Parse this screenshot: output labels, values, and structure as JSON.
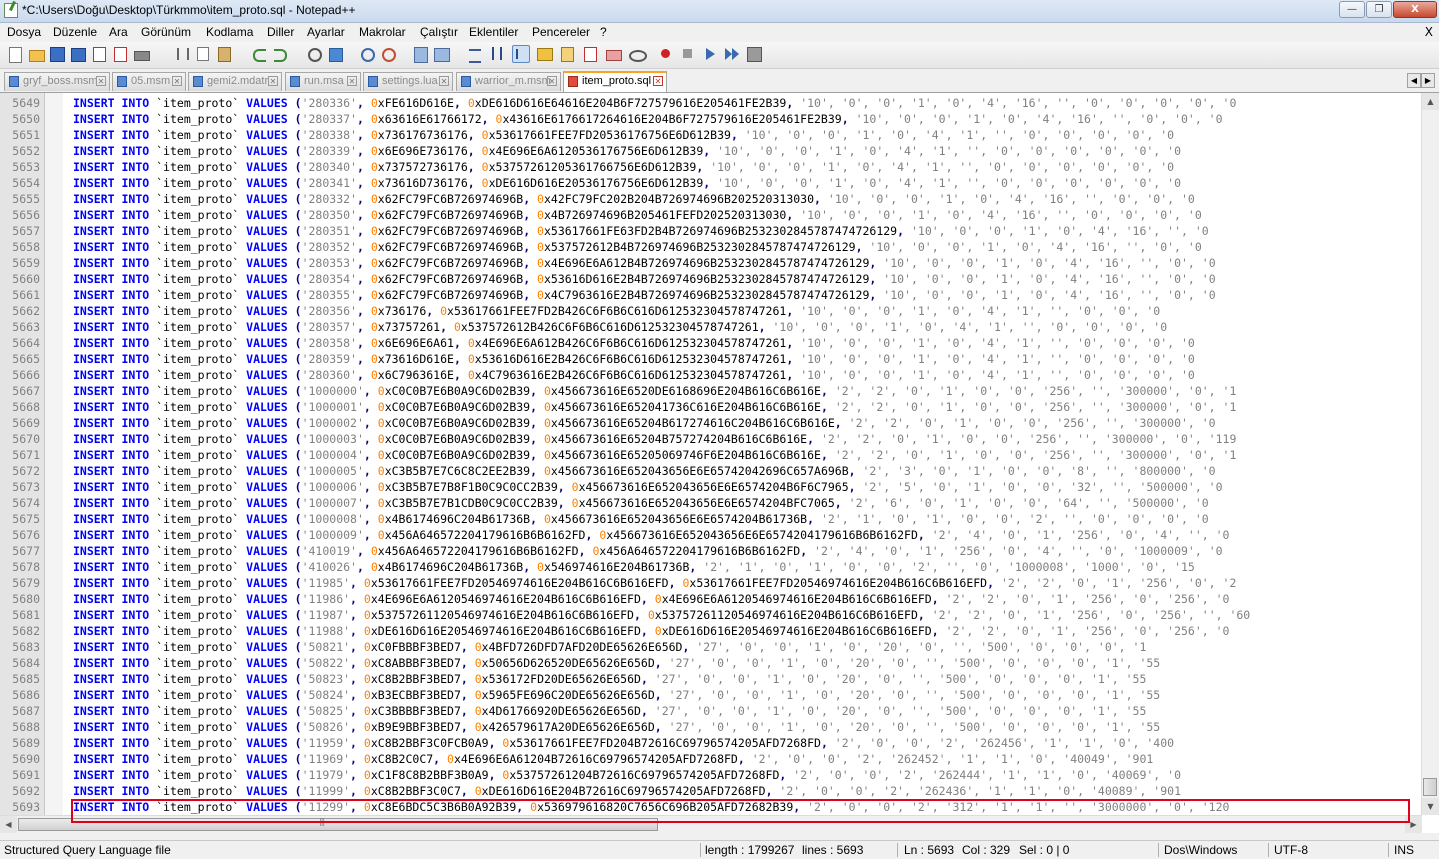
{
  "window": {
    "title": "*C:\\Users\\Doğu\\Desktop\\Türkmmo\\item_proto.sql - Notepad++",
    "minimize_label": "—",
    "restore_label": "❐",
    "close_label": "X"
  },
  "menu": {
    "items": [
      "Dosya",
      "Düzenle",
      "Ara",
      "Görünüm",
      "Kodlama",
      "Diller",
      "Ayarlar",
      "Makrolar",
      "Çalıştır",
      "Eklentiler",
      "Pencereler",
      "?"
    ],
    "close_doc": "X"
  },
  "tabs": [
    {
      "label": "gryf_boss.msm",
      "active": false
    },
    {
      "label": "05.msm",
      "active": false
    },
    {
      "label": "gemi2.mdatr",
      "active": false
    },
    {
      "label": "run.msa",
      "active": false
    },
    {
      "label": "settings.lua",
      "active": false
    },
    {
      "label": "warrior_m.msm",
      "active": false
    },
    {
      "label": "item_proto.sql",
      "active": true
    }
  ],
  "code": {
    "kw_insert": "INSERT",
    "kw_into": "INTO",
    "table": "`item_proto`",
    "kw_values": "VALUES",
    "lines": [
      {
        "n": "5649",
        "id": "'280336'",
        "h1": "FE616D616E",
        "h2": "DE616D616E64616E204B6F727579616E205461FE2B39",
        "rest": "'10', '0', '0', '1', '0', '4', '16', '', '0', '0', '0', '0', '0"
      },
      {
        "n": "5650",
        "id": "'280337'",
        "h1": "63616E61766172",
        "h2": "43616E6176617264616E204B6F727579616E205461FE2B39",
        "rest": "'10', '0', '0', '1', '0', '4', '16', '', '0', '0', '0"
      },
      {
        "n": "5651",
        "id": "'280338'",
        "h1": "736176736176",
        "h2": "53617661FEE7FD20536176756E6D612B39",
        "rest": "'10', '0', '0', '1', '0', '4', '1', '', '0', '0', '0', '0', '0"
      },
      {
        "n": "5652",
        "id": "'280339'",
        "h1": "6E696E736176",
        "h2": "4E696E6A6120536176756E6D612B39",
        "rest": "'10', '0', '0', '1', '0', '4', '1', '', '0', '0', '0', '0', '0', '0"
      },
      {
        "n": "5653",
        "id": "'280340'",
        "h1": "737572736176",
        "h2": "53757261205361766756E6D612B39",
        "rest": "'10', '0', '0', '1', '0', '4', '1', '', '0', '0', '0', '0', '0', '0"
      },
      {
        "n": "5654",
        "id": "'280341'",
        "h1": "73616D736176",
        "h2": "DE616D616E20536176756E6D612B39",
        "rest": "'10', '0', '0', '1', '0', '4', '1', '', '0', '0', '0', '0', '0', '0"
      },
      {
        "n": "5655",
        "id": "'280332'",
        "h1": "62FC79FC6B726974696B",
        "h2": "42FC79FC202B204B726974696B202520313030",
        "rest": "'10', '0', '0', '1', '0', '4', '16', '', '0', '0', '0"
      },
      {
        "n": "5656",
        "id": "'280350'",
        "h1": "62FC79FC6B726974696B",
        "h2": "4B726974696B205461FEFD202520313030",
        "rest": "'10', '0', '0', '1', '0', '4', '16', '', '0', '0', '0', '0"
      },
      {
        "n": "5657",
        "id": "'280351'",
        "h1": "62FC79FC6B726974696B",
        "h2": "53617661FE63FD2B4B726974696B2532302845787474726129",
        "rest": "'10', '0', '0', '1', '0', '4', '16', '', '0"
      },
      {
        "n": "5658",
        "id": "'280352'",
        "h1": "62FC79FC6B726974696B",
        "h2": "537572612B4B726974696B2532302845787474726129",
        "rest": "'10', '0', '0', '1', '0', '4', '16', '', '0', '0"
      },
      {
        "n": "5659",
        "id": "'280353'",
        "h1": "62FC79FC6B726974696B",
        "h2": "4E696E6A612B4B726974696B2532302845787474726129",
        "rest": "'10', '0', '0', '1', '0', '4', '16', '', '0', '0"
      },
      {
        "n": "5660",
        "id": "'280354'",
        "h1": "62FC79FC6B726974696B",
        "h2": "53616D616E2B4B726974696B2532302845787474726129",
        "rest": "'10', '0', '0', '1', '0', '4', '16', '', '0', '0"
      },
      {
        "n": "5661",
        "id": "'280355'",
        "h1": "62FC79FC6B726974696B",
        "h2": "4C7963616E2B4B726974696B2532302845787474726129",
        "rest": "'10', '0', '0', '1', '0', '4', '16', '', '0', '0"
      },
      {
        "n": "5662",
        "id": "'280356'",
        "h1": "736176",
        "h2": "53617661FEE7FD2B426C6F6B6C616D612532304578747261",
        "rest": "'10', '0', '0', '1', '0', '4', '1', '', '0', '0', '0"
      },
      {
        "n": "5663",
        "id": "'280357'",
        "h1": "73757261",
        "h2": "537572612B426C6F6B6C616D612532304578747261",
        "rest": "'10', '0', '0', '1', '0', '4', '1', '', '0', '0', '0', '0"
      },
      {
        "n": "5664",
        "id": "'280358'",
        "h1": "6E696E6A61",
        "h2": "4E696E6A612B426C6F6B6C616D612532304578747261",
        "rest": "'10', '0', '0', '1', '0', '4', '1', '', '0', '0', '0', '0"
      },
      {
        "n": "5665",
        "id": "'280359'",
        "h1": "73616D616E",
        "h2": "53616D616E2B426C6F6B6C616D612532304578747261",
        "rest": "'10', '0', '0', '1', '0', '4', '1', '', '0', '0', '0', '0"
      },
      {
        "n": "5666",
        "id": "'280360'",
        "h1": "6C7963616E",
        "h2": "4C7963616E2B426C6F6B6C616D612532304578747261",
        "rest": "'10', '0', '0', '1', '0', '4', '1', '', '0', '0', '0', '0"
      },
      {
        "n": "5667",
        "id": "'1000000'",
        "h1": "C0C0B7E6B0A9C6D02B39",
        "h2": "456673616E6520DE6168696E204B616C6B616E",
        "rest": "'2', '2', '0', '1', '0', '0', '256', '', '300000', '0', '1"
      },
      {
        "n": "5668",
        "id": "'1000001'",
        "h1": "C0C0B7E6B0A9C6D02B39",
        "h2": "456673616E652041736C616E204B616C6B616E",
        "rest": "'2', '2', '0', '1', '0', '0', '256', '', '300000', '0', '1"
      },
      {
        "n": "5669",
        "id": "'1000002'",
        "h1": "C0C0B7E6B0A9C6D02B39",
        "h2": "456673616E65204B617274616C204B616C6B616E",
        "rest": "'2', '2', '0', '1', '0', '0', '256', '', '300000', '0"
      },
      {
        "n": "5670",
        "id": "'1000003'",
        "h1": "C0C0B7E6B0A9C6D02B39",
        "h2": "456673616E65204B757274204B616C6B616E",
        "rest": "'2', '2', '0', '1', '0', '0', '256', '', '300000', '0', '119"
      },
      {
        "n": "5671",
        "id": "'1000004'",
        "h1": "C0C0B7E6B0A9C6D02B39",
        "h2": "456673616E65205069746F6E204B616C6B616E",
        "rest": "'2', '2', '0', '1', '0', '0', '256', '', '300000', '0', '1"
      },
      {
        "n": "5672",
        "id": "'1000005'",
        "h1": "C3B5B7E7C6C8C2EE2B39",
        "h2": "456673616E652043656E6E65742042696C657A696B",
        "rest": "'2', '3', '0', '1', '0', '0', '8', '', '800000', '0"
      },
      {
        "n": "5673",
        "id": "'1000006'",
        "h1": "C3B5B7E7B8F1B0C9C0CC2B39",
        "h2": "456673616E652043656E6E6574204B6F6C7965",
        "rest": "'2', '5', '0', '1', '0', '0', '32', '', '500000', '0"
      },
      {
        "n": "5674",
        "id": "'1000007'",
        "h1": "C3B5B7E7B1CDB0C9C0CC2B39",
        "h2": "456673616E652043656E6E6574204BFC7065",
        "rest": "'2', '6', '0', '1', '0', '0', '64', '', '500000', '0"
      },
      {
        "n": "5675",
        "id": "'1000008'",
        "h1": "4B6174696C204B61736B",
        "h2": "456673616E652043656E6E6574204B61736B",
        "rest": "'2', '1', '0', '1', '0', '0', '2', '', '0', '0', '0', '0"
      },
      {
        "n": "5676",
        "id": "'1000009'",
        "h1": "456A646572204179616B6B6162FD",
        "h2": "456673616E652043656E6E6574204179616B6B6162FD",
        "rest": "'2', '4', '0', '1', '256', '0', '4', '', '0"
      },
      {
        "n": "5677",
        "id": "'410019'",
        "h1": "456A646572204179616B6B6162FD",
        "h2": "456A646572204179616B6B6162FD",
        "rest": "'2', '4', '0', '1', '256', '0', '4', '', '0', '1000009', '0"
      },
      {
        "n": "5678",
        "id": "'410026'",
        "h1": "4B6174696C204B61736B",
        "h2": "546974616E204B61736B",
        "rest": "'2', '1', '0', '1', '0', '0', '2', '', '0', '1000008', '1000', '0', '15"
      },
      {
        "n": "5679",
        "id": "'11985'",
        "h1": "53617661FEE7FD20546974616E204B616C6B616EFD",
        "h2": "53617661FEE7FD20546974616E204B616C6B616EFD",
        "rest": "'2', '2', '0', '1', '256', '0', '2"
      },
      {
        "n": "5680",
        "id": "'11986'",
        "h1": "4E696E6A6120546974616E204B616C6B616EFD",
        "h2": "4E696E6A6120546974616E204B616C6B616EFD",
        "rest": "'2', '2', '0', '1', '256', '0', '256', '0"
      },
      {
        "n": "5681",
        "id": "'11987'",
        "h1": "53757261120546974616E204B616C6B616EFD",
        "h2": "53757261120546974616E204B616C6B616EFD",
        "rest": "'2', '2', '0', '1', '256', '0', '256', '', '60"
      },
      {
        "n": "5682",
        "id": "'11988'",
        "h1": "DE616D616E20546974616E204B616C6B616EFD",
        "h2": "DE616D616E20546974616E204B616C6B616EFD",
        "rest": "'2', '2', '0', '1', '256', '0', '256', '0"
      },
      {
        "n": "5683",
        "id": "'50821'",
        "h1": "C0FBBBF3BED7",
        "h2": "4BFD726DFD7AFD20DE65626E656D",
        "rest": "'27', '0', '0', '1', '0', '20', '0', '', '500', '0', '0', '0', '1"
      },
      {
        "n": "5684",
        "id": "'50822'",
        "h1": "C8ABBBF3BED7",
        "h2": "50656D626520DE65626E656D",
        "rest": "'27', '0', '0', '1', '0', '20', '0', '', '500', '0', '0', '0', '1', '55"
      },
      {
        "n": "5685",
        "id": "'50823'",
        "h1": "C8B2BBF3BED7",
        "h2": "536172FD20DE65626E656D",
        "rest": "'27', '0', '0', '1', '0', '20', '0', '', '500', '0', '0', '0', '1', '55"
      },
      {
        "n": "5686",
        "id": "'50824'",
        "h1": "B3ECBBF3BED7",
        "h2": "5965FE696C20DE65626E656D",
        "rest": "'27', '0', '0', '1', '0', '20', '0', '', '500', '0', '0', '0', '1', '55"
      },
      {
        "n": "5687",
        "id": "'50825'",
        "h1": "C3BBBBF3BED7",
        "h2": "4D61766920DE65626E656D",
        "rest": "'27', '0', '0', '1', '0', '20', '0', '', '500', '0', '0', '0', '1', '55"
      },
      {
        "n": "5688",
        "id": "'50826'",
        "h1": "B9E9BBF3BED7",
        "h2": "426579617A20DE65626E656D",
        "rest": "'27', '0', '0', '1', '0', '20', '0', '', '500', '0', '0', '0', '1', '55"
      },
      {
        "n": "5689",
        "id": "'11959'",
        "h1": "C8B2BBF3C0FCB0A9",
        "h2": "53617661FEE7FD204B72616C69796574205AFD7268FD",
        "rest": "'2', '0', '0', '2', '262456', '1', '1', '0', '400"
      },
      {
        "n": "5690",
        "id": "'11969'",
        "h1": "C8B2C0C7",
        "h2": "4E696E6A61204B72616C69796574205AFD7268FD",
        "rest": "'2', '0', '0', '2', '262452', '1', '1', '0', '40049', '901"
      },
      {
        "n": "5691",
        "id": "'11979'",
        "h1": "C1F8C8B2BBF3B0A9",
        "h2": "53757261204B72616C69796574205AFD7268FD",
        "rest": "'2', '0', '0', '2', '262444', '1', '1', '0', '40069', '0"
      },
      {
        "n": "5692",
        "id": "'11999'",
        "h1": "C8B2BBF3C0C7",
        "h2": "DE616D616E204B72616C69796574205AFD7268FD",
        "rest": "'2', '0', '0', '2', '262436', '1', '1', '0', '40089', '901"
      },
      {
        "n": "5693",
        "id": "'11299'",
        "h1": "C8E6BDC5C3B6B0A92B39",
        "h2": "536979616820C7656C696B205AFD72682B39",
        "rest": "'2', '0', '0', '2', '312', '1', '1', '', '3000000', '0', '120"
      }
    ]
  },
  "status": {
    "language": "Structured Query Language file",
    "length": "length : 1799267",
    "lines": "lines : 5693",
    "ln": "Ln : 5693",
    "col": "Col : 329",
    "sel": "Sel : 0 | 0",
    "eol": "Dos\\Windows",
    "encoding": "UTF-8",
    "mode": "INS"
  },
  "colors": {
    "keyword": "#0000ff",
    "string": "#808080",
    "hex_prefix": "#ff8000",
    "highlight_border": "#e0001a",
    "active_tab_accent": "#f5a623"
  }
}
